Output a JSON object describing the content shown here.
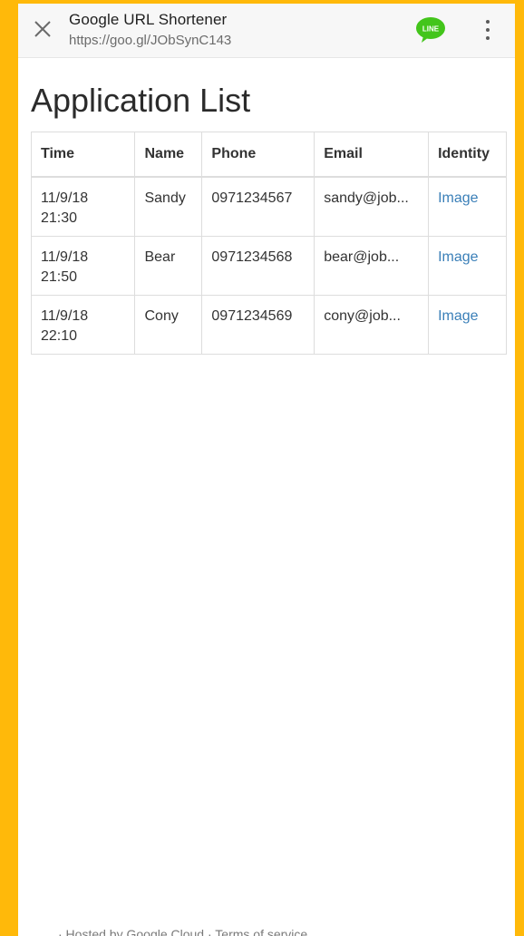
{
  "browser": {
    "title": "Google URL Shortener",
    "url": "https://goo.gl/JObSynC143",
    "close_icon": "close-icon",
    "line_label": "LINE",
    "line_color": "#43C51B",
    "menu_icon": "more-vert-icon"
  },
  "page": {
    "title": "Application List",
    "bottom_text": "· Hosted by Google Cloud · Terms of service"
  },
  "table": {
    "headers": [
      "Time",
      "Name",
      "Phone",
      "Email",
      "Identity"
    ],
    "rows": [
      {
        "time_date": "11/9/18",
        "time_clock": "21:30",
        "name": "Sandy",
        "phone": "0971234567",
        "email": "sandy@job...",
        "identity": "Image"
      },
      {
        "time_date": "11/9/18",
        "time_clock": "21:50",
        "name": "Bear",
        "phone": "0971234568",
        "email": "bear@job...",
        "identity": "Image"
      },
      {
        "time_date": "11/9/18",
        "time_clock": "22:10",
        "name": "Cony",
        "phone": "0971234569",
        "email": "cony@job...",
        "identity": "Image"
      }
    ]
  },
  "colors": {
    "frame_background": "#FFB90A",
    "link": "#3A7FB8"
  }
}
